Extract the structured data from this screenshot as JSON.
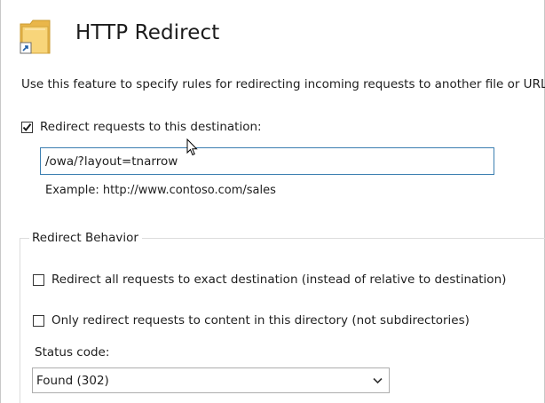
{
  "header": {
    "icon": "http-redirect-feature-icon",
    "title": "HTTP Redirect"
  },
  "description": "Use this feature to specify rules for redirecting incoming requests to another file or URL.",
  "redirect_destination": {
    "checkbox_label": "Redirect requests to this destination:",
    "checked": true,
    "input_value": "/owa/?layout=tnarrow",
    "example": "Example: http://www.contoso.com/sales"
  },
  "redirect_behavior": {
    "legend": "Redirect Behavior",
    "exact_destination": {
      "label": "Redirect all requests to exact destination (instead of relative to destination)",
      "checked": false
    },
    "this_directory_only": {
      "label": "Only redirect requests to content in this directory (not subdirectories)",
      "checked": false
    },
    "status_code": {
      "label": "Status code:",
      "selected": "Found (302)"
    }
  },
  "colors": {
    "input_focus_border": "#3c7fb1",
    "folder_yellow": "#f5c85a"
  }
}
